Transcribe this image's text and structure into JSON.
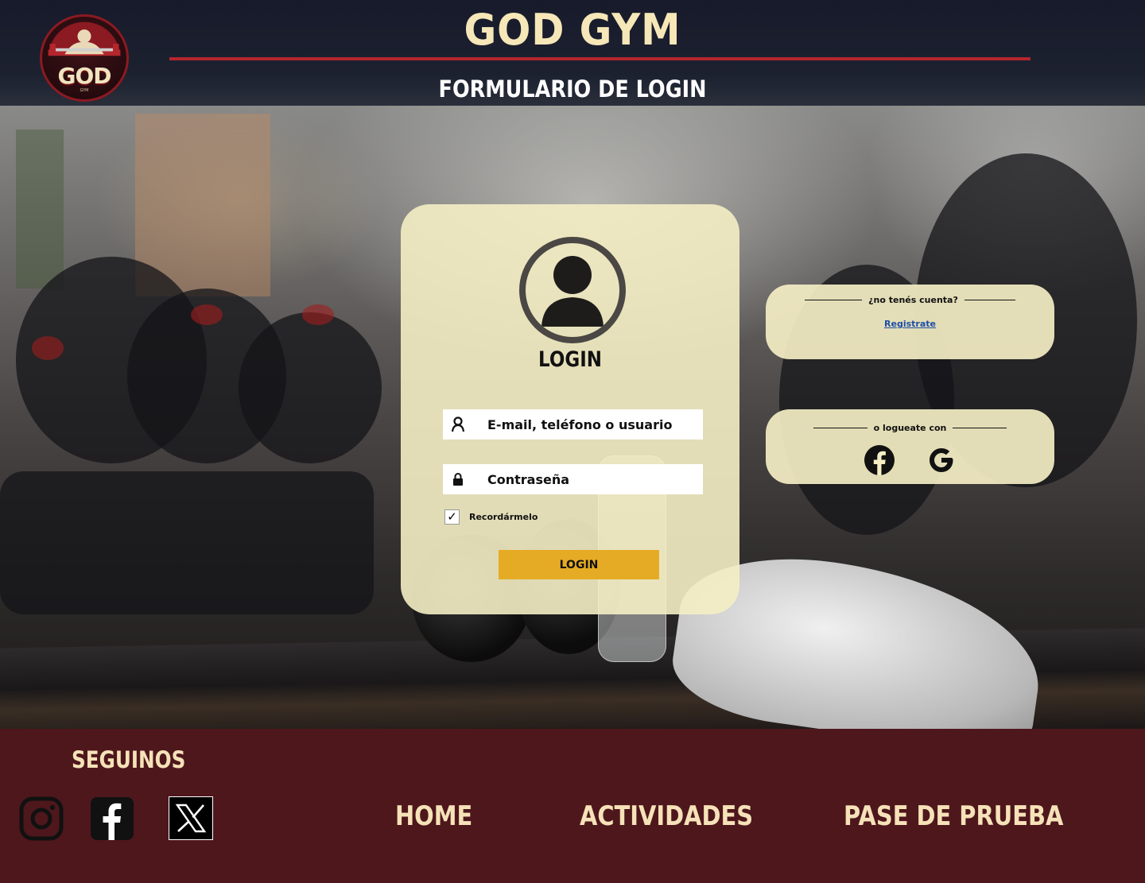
{
  "header": {
    "logo_text": "GOD",
    "logo_subtext": "GYM",
    "site_title": "GOD GYM",
    "page_subtitle": "FORMULARIO DE LOGIN"
  },
  "login_card": {
    "avatar_icon": "user-avatar-icon",
    "heading": "LOGIN",
    "username_placeholder": "E-mail, teléfono o usuario",
    "password_placeholder": "Contraseña",
    "remember_label": "Recordármelo",
    "remember_checked": true,
    "submit_label": "LOGIN"
  },
  "register_card": {
    "prompt": "¿no tenés cuenta?",
    "link_label": "Registrate"
  },
  "social_login_card": {
    "prompt": "o logueate con",
    "providers": [
      "facebook-icon",
      "google-icon"
    ]
  },
  "footer": {
    "follow_title": "SEGUINOS",
    "social_links": [
      "instagram-icon",
      "facebook-icon",
      "x-icon"
    ],
    "nav": {
      "home": "HOME",
      "activities": "ACTIVIDADES",
      "trial": "PASE DE PRUEBA"
    }
  },
  "colors": {
    "header_bg": "#171a2a",
    "accent_red": "#b3262d",
    "title_cream": "#f6e7b8",
    "card_bg": "#f4eec4",
    "button_yellow": "#e6ab24",
    "link_blue": "#1d4ea8",
    "footer_bg": "#4e171c"
  }
}
